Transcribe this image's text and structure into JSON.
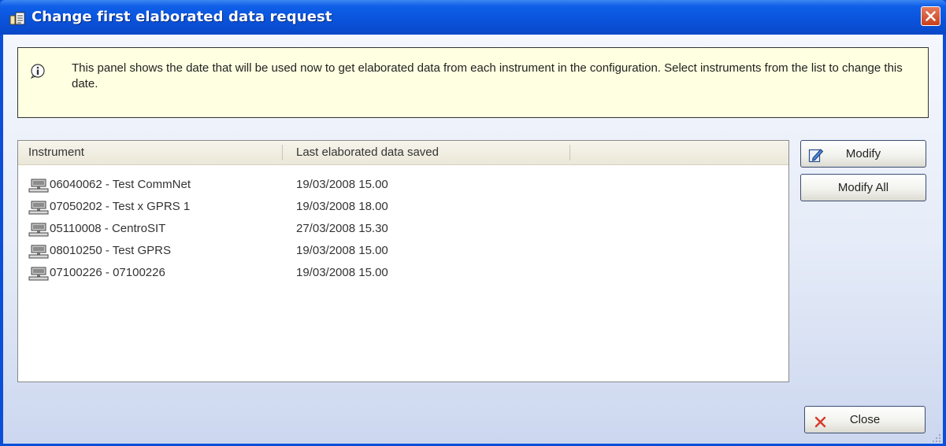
{
  "window": {
    "title": "Change first elaborated data request"
  },
  "info": {
    "text": "This panel shows  the date that will be used now to get elaborated data from each instrument in the configuration. Select instruments from the list to change this date."
  },
  "list": {
    "columns": [
      "Instrument",
      "Last elaborated data saved"
    ],
    "rows": [
      {
        "instrument": "06040062 - Test CommNet",
        "last_saved": "19/03/2008 15.00"
      },
      {
        "instrument": "07050202 - Test x GPRS 1",
        "last_saved": "19/03/2008 18.00"
      },
      {
        "instrument": "05110008 - CentroSIT",
        "last_saved": "27/03/2008 15.30"
      },
      {
        "instrument": "08010250 - Test GPRS",
        "last_saved": "19/03/2008 15.00"
      },
      {
        "instrument": "07100226 - 07100226",
        "last_saved": "19/03/2008 15.00"
      }
    ]
  },
  "buttons": {
    "modify": "Modify",
    "modify_all": "Modify All",
    "close": "Close"
  },
  "icons": {
    "title": "app-window-icon",
    "close": "close-icon",
    "info": "info-icon",
    "row": "computer-icon",
    "modify": "edit-icon",
    "close_button": "red-x-icon"
  },
  "colors": {
    "titlebar": "#0a52da",
    "info_background": "#ffffe1",
    "close_red": "#d63a2a"
  }
}
